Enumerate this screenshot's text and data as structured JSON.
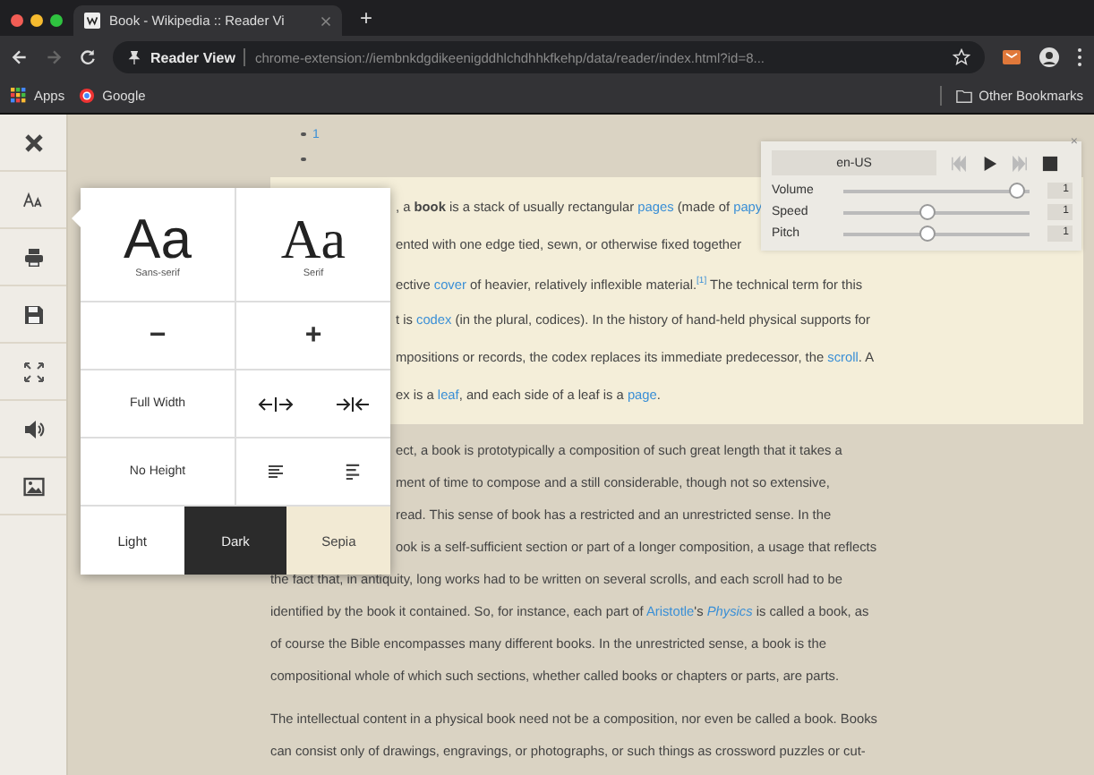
{
  "browser": {
    "tab_title": "Book - Wikipedia :: Reader Vi",
    "new_tab": "+",
    "page_label": "Reader View",
    "url": "chrome-extension://iembnkdgdikeenigddhlchdhhkfkehp/data/reader/index.html?id=8...",
    "bookmarks": [
      {
        "label": "Apps",
        "kind": "apps"
      },
      {
        "label": "Google",
        "kind": "site"
      }
    ],
    "other_bookmarks": "Other Bookmarks"
  },
  "sidebar": {
    "tools": [
      {
        "kind": "close"
      },
      {
        "kind": "font"
      },
      {
        "kind": "print"
      },
      {
        "kind": "save"
      },
      {
        "kind": "fullscreen"
      },
      {
        "kind": "speak"
      },
      {
        "kind": "images"
      }
    ]
  },
  "list_items": [
    "1"
  ],
  "paragraphs": [
    {
      "highlighted": true,
      "lines": [
        [
          {
            "kind": "text",
            "text": ", a **book** is a stack of usually rectangular "
          },
          {
            "kind": "link",
            "text": "pages"
          },
          {
            "kind": "text",
            "text": " (made of "
          },
          {
            "kind": "link",
            "text": "papy"
          }
        ],
        [
          {
            "kind": "text",
            "text": "ented with one edge tied, sewn, or otherwise fixed together"
          }
        ],
        [
          {
            "kind": "text",
            "text": "ective "
          },
          {
            "kind": "link",
            "text": "cover"
          },
          {
            "kind": "text",
            "text": " of heavier, relatively inflexible material."
          },
          {
            "kind": "ref",
            "text": "[1]"
          },
          {
            "kind": "text",
            "text": " The technical term for this"
          }
        ],
        [
          {
            "kind": "text",
            "text": "t is "
          },
          {
            "kind": "link",
            "text": "codex"
          },
          {
            "kind": "text",
            "text": " (in the plural, codices). In the history of hand-held physical supports for"
          }
        ],
        [
          {
            "kind": "text",
            "text": "mpositions or records, the codex replaces its immediate predecessor, the "
          },
          {
            "kind": "link",
            "text": "scroll"
          },
          {
            "kind": "text",
            "text": ". A"
          }
        ],
        [
          {
            "kind": "text",
            "text": "ex is a "
          },
          {
            "kind": "link",
            "text": "leaf"
          },
          {
            "kind": "text",
            "text": ", and each side of a leaf is a "
          },
          {
            "kind": "link",
            "text": "page"
          },
          {
            "kind": "text",
            "text": "."
          }
        ]
      ]
    },
    {
      "highlighted": false,
      "lines": [
        [
          {
            "kind": "text",
            "text": "ect, a book is prototypically a composition of such great length that it takes a"
          }
        ],
        [
          {
            "kind": "text",
            "text": "ment of time to compose and a still considerable, though not so extensive,"
          }
        ],
        [
          {
            "kind": "text",
            "text": "read. This sense of book has a restricted and an unrestricted sense. In the"
          }
        ],
        [
          {
            "kind": "text",
            "text": "ook is a self-sufficient section or part of a longer composition, a usage that reflects"
          }
        ],
        [
          {
            "kind": "text",
            "text": "the fact that, in antiquity, long works had to be written on several scrolls, and each scroll had to be"
          }
        ],
        [
          {
            "kind": "text",
            "text": "identified by the book it contained. So, for instance, each part of "
          },
          {
            "kind": "link",
            "text": "Aristotle"
          },
          {
            "kind": "text",
            "text": "'s "
          },
          {
            "kind": "link",
            "text": "*Physics*"
          },
          {
            "kind": "text",
            "text": " is called a book, as"
          }
        ],
        [
          {
            "kind": "text",
            "text": "of course the Bible encompasses many different books. In the unrestricted sense, a book is the"
          }
        ],
        [
          {
            "kind": "text",
            "text": "compositional whole of which such sections, whether called books or chapters or parts, are parts."
          }
        ]
      ]
    },
    {
      "highlighted": false,
      "lines": [
        [
          {
            "kind": "text",
            "text": "The intellectual content in a physical book need not be a composition, nor even be called a book. Books"
          }
        ],
        [
          {
            "kind": "text",
            "text": "can consist only of drawings, engravings, or photographs, or such things as crossword puzzles or cut-"
          }
        ]
      ]
    }
  ],
  "settings_popup": {
    "fonts": [
      {
        "sample": "Aa",
        "label": "Sans-serif",
        "kind": "sans"
      },
      {
        "sample": "Aa",
        "label": "Serif",
        "kind": "serif"
      }
    ],
    "size_buttons": [
      "−",
      "+"
    ],
    "width_label": "Full Width",
    "height_label": "No Height",
    "themes": [
      {
        "label": "Light",
        "kind": "light"
      },
      {
        "label": "Dark",
        "kind": "dark"
      },
      {
        "label": "Sepia",
        "kind": "sepia"
      }
    ]
  },
  "speech_panel": {
    "close": "×",
    "voice": "en-US",
    "sliders": [
      {
        "label": "Volume",
        "level": 0.97,
        "reading": "1"
      },
      {
        "label": "Speed",
        "level": 0.45,
        "reading": "1"
      },
      {
        "label": "Pitch",
        "level": 0.45,
        "reading": "1"
      }
    ]
  }
}
